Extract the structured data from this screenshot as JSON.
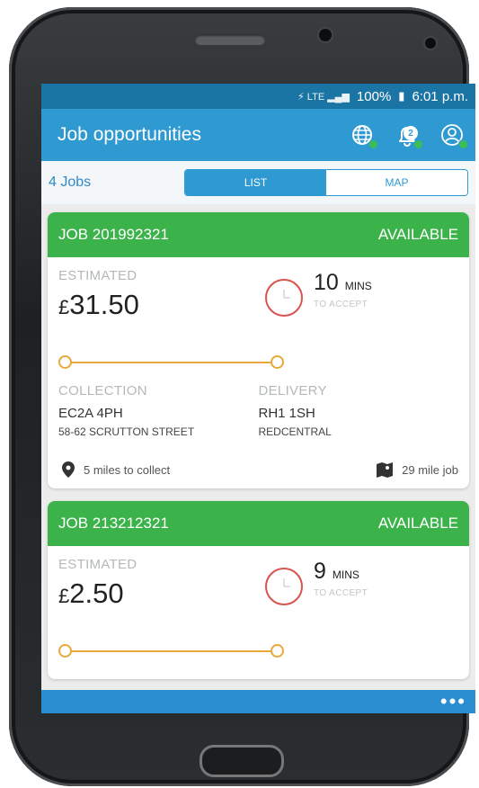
{
  "status_bar": {
    "time": "6:01 p.m.",
    "battery": "100%"
  },
  "app_bar": {
    "title": "Job opportunities",
    "notification_count": "2"
  },
  "controls": {
    "jobs_count": "4 Jobs",
    "segments": [
      "LIST",
      "MAP"
    ],
    "selected": "LIST"
  },
  "jobs": [
    {
      "id": "JOB 201992321",
      "status": "AVAILABLE",
      "estimated_label": "ESTIMATED",
      "currency": "£",
      "price": "31.50",
      "mins_value": "10",
      "mins_unit": "MINS",
      "accept_label": "TO ACCEPT",
      "collection_label": "COLLECTION",
      "collection_postcode": "EC2A 4PH",
      "collection_street": "58-62 SCRUTTON STREET",
      "delivery_label": "DELIVERY",
      "delivery_postcode": "RH1 1SH",
      "delivery_street": "REDCENTRAL",
      "distance_collect": "5 miles to collect",
      "job_distance": "29 mile job"
    },
    {
      "id": "JOB 213212321",
      "status": "AVAILABLE",
      "estimated_label": "ESTIMATED",
      "currency": "£",
      "price": "2.50",
      "mins_value": "9",
      "mins_unit": "MINS",
      "accept_label": "TO ACCEPT"
    }
  ],
  "bottom_bar": {
    "more_label": "•••"
  },
  "colors": {
    "status_bar": "#1a74a4",
    "app_bar": "#2f9ad2",
    "card_header": "#3cb34a",
    "route": "#e8a93a",
    "timer_ring": "#d9534f"
  }
}
